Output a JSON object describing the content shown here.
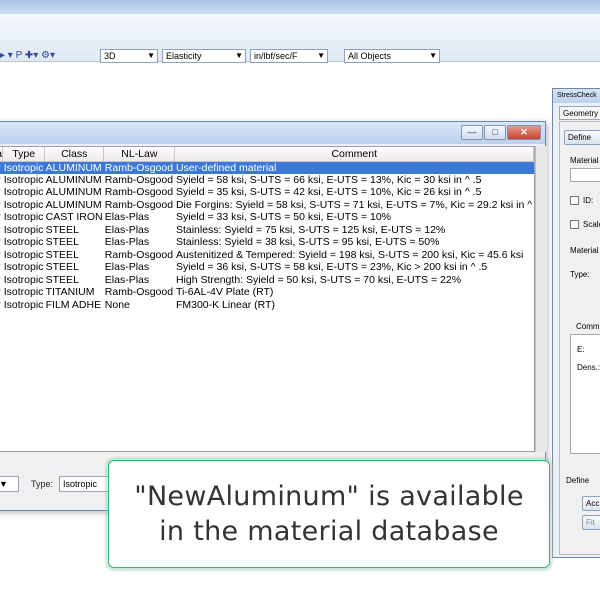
{
  "toolbar": {
    "icons_text": "▸ ▾ P ✚▾ ⚙▾",
    "selects": [
      {
        "value": "3D"
      },
      {
        "value": "Elasticity"
      },
      {
        "value": "in/lbf/sec/F"
      },
      {
        "value": "All Objects"
      }
    ]
  },
  "dialog": {
    "min_label": "—",
    "max_label": "□",
    "close_label": "✕"
  },
  "table": {
    "columns": [
      "a",
      "Type",
      "Class",
      "NL-Law",
      "Comment"
    ],
    "rows": [
      [
        "r",
        "Isotropic",
        "ALUMINUM",
        "Ramb-Osgood",
        "User-defined material"
      ],
      [
        "r",
        "Isotropic",
        "ALUMINUM",
        "Ramb-Osgood",
        "Syield = 58 ksi, S-UTS = 66 ksi, E-UTS = 13%, Kic = 30 ksi in ^ .5"
      ],
      [
        "r",
        "Isotropic",
        "ALUMINUM",
        "Ramb-Osgood",
        "Syield = 35 ksi, S-UTS = 42 ksi, E-UTS = 10%, Kic = 26 ksi in ^ .5"
      ],
      [
        "r",
        "Isotropic",
        "ALUMINUM",
        "Ramb-Osgood",
        "Die Forgins: Syield = 58 ksi, S-UTS = 71 ksi, E-UTS = 7%, Kic = 29.2 ksi in ^"
      ],
      [
        "r",
        "Isotropic",
        "CAST IRON",
        "Elas-Plas",
        "Syield = 33 ksi, S-UTS = 50 ksi, E-UTS = 10%"
      ],
      [
        "r",
        "Isotropic",
        "STEEL",
        "Elas-Plas",
        "Stainless: Syield = 75 ksi, S-UTS = 125 ksi, E-UTS = 12%"
      ],
      [
        "r",
        "Isotropic",
        "STEEL",
        "Elas-Plas",
        "Stainless: Syield = 38 ksi, S-UTS = 95 ksi, E-UTS = 50%"
      ],
      [
        "r",
        "Isotropic",
        "STEEL",
        "Ramb-Osgood",
        "Austenitized & Tempered: Syield = 198 ksi, S-UTS = 200 ksi, Kic = 45.6 ksi"
      ],
      [
        "r",
        "Isotropic",
        "STEEL",
        "Elas-Plas",
        "Syield = 36 ksi, S-UTS = 58 ksi, E-UTS = 23%, Kic > 200 ksi in ^ .5"
      ],
      [
        "r",
        "Isotropic",
        "STEEL",
        "Elas-Plas",
        "High Strength: Syield = 50 ksi, S-UTS = 70 ksi, E-UTS = 22%"
      ],
      [
        "r",
        "Isotropic",
        "TITANIUM",
        "Ramb-Osgood",
        "Ti-6AL-4V Plate (RT)"
      ],
      [
        "r",
        "Isotropic",
        "FILM ADHE",
        "None",
        "FM300-K Linear (RT)"
      ]
    ],
    "selected_row": 0
  },
  "bottom": {
    "type_label": "Type:",
    "type_value": "Isotropic"
  },
  "right_panel": {
    "title": "StressCheck",
    "tab": "Geometry",
    "define_button": "Define",
    "material_label": "Material",
    "id_label": "ID:",
    "scale_label": "Scale",
    "material_label2": "Material",
    "type_label": "Type:",
    "comment_label": "Comm",
    "e_label": "E:",
    "dens_label": "Dens.:",
    "define_label": "Define",
    "accept_button": "Acc",
    "fit_button": "Fit"
  },
  "caption": {
    "line1": "\"NewAluminum\" is available",
    "line2": "in the material database"
  }
}
